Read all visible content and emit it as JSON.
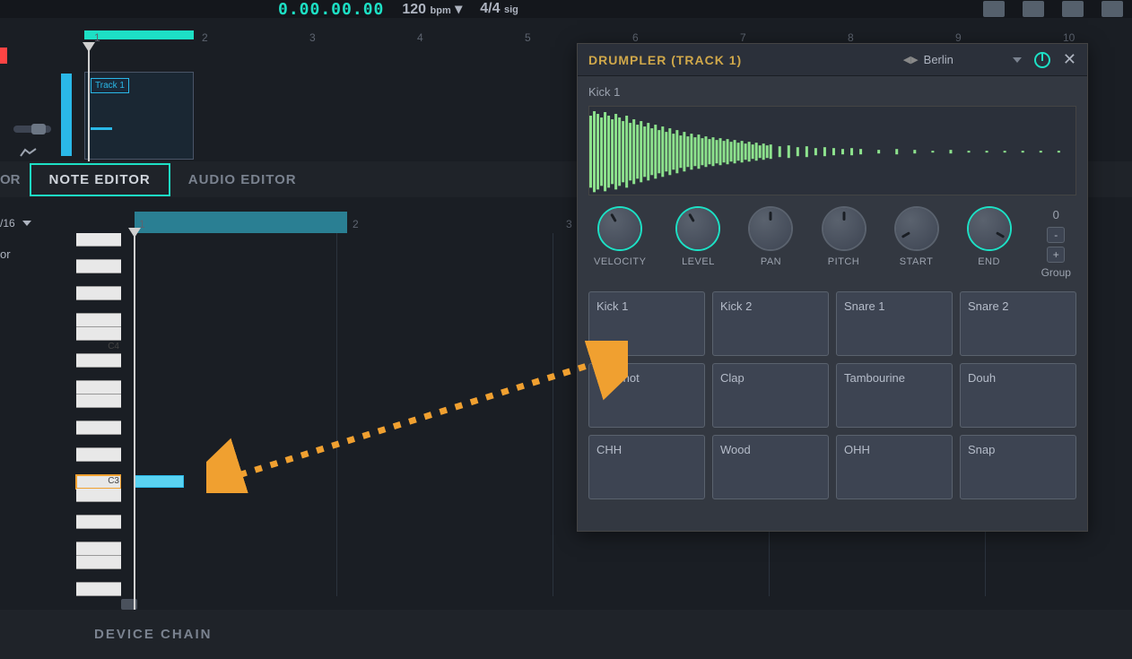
{
  "topbar": {
    "time": "0.00.00.00",
    "bpm_value": "120",
    "bpm_suffix": "bpm",
    "sig_value": "4/4",
    "sig_suffix": "sig"
  },
  "timeline": {
    "markers": [
      "1",
      "2",
      "3",
      "4",
      "5",
      "6",
      "7",
      "8",
      "9",
      "10"
    ]
  },
  "track": {
    "clip_label": "Track 1"
  },
  "editor_tabs": {
    "partial": "OR",
    "note": "NOTE EDITOR",
    "audio": "AUDIO EDITOR"
  },
  "note_editor": {
    "snap": "/16",
    "ruler_marks": [
      "1",
      "2",
      "3"
    ],
    "piano_labels": {
      "c4": "C4",
      "c3": "C3"
    },
    "or_partial": "or"
  },
  "bottom": {
    "label": "DEVICE CHAIN"
  },
  "plugin": {
    "title": "DRUMPLER (TRACK 1)",
    "preset": "Berlin",
    "sample": "Kick 1",
    "knobs": [
      {
        "label": "VELOCITY",
        "accent": true
      },
      {
        "label": "LEVEL",
        "accent": true
      },
      {
        "label": "PAN",
        "accent": false
      },
      {
        "label": "PITCH",
        "accent": false
      },
      {
        "label": "START",
        "accent": false
      },
      {
        "label": "END",
        "accent": true
      }
    ],
    "group": {
      "num": "0",
      "minus": "-",
      "plus": "+",
      "label": "Group"
    },
    "pads": [
      "Kick 1",
      "Kick 2",
      "Snare 1",
      "Snare 2",
      "Rimshot",
      "Clap",
      "Tambourine",
      "Douh",
      "CHH",
      "Wood",
      "OHH",
      "Snap"
    ]
  }
}
